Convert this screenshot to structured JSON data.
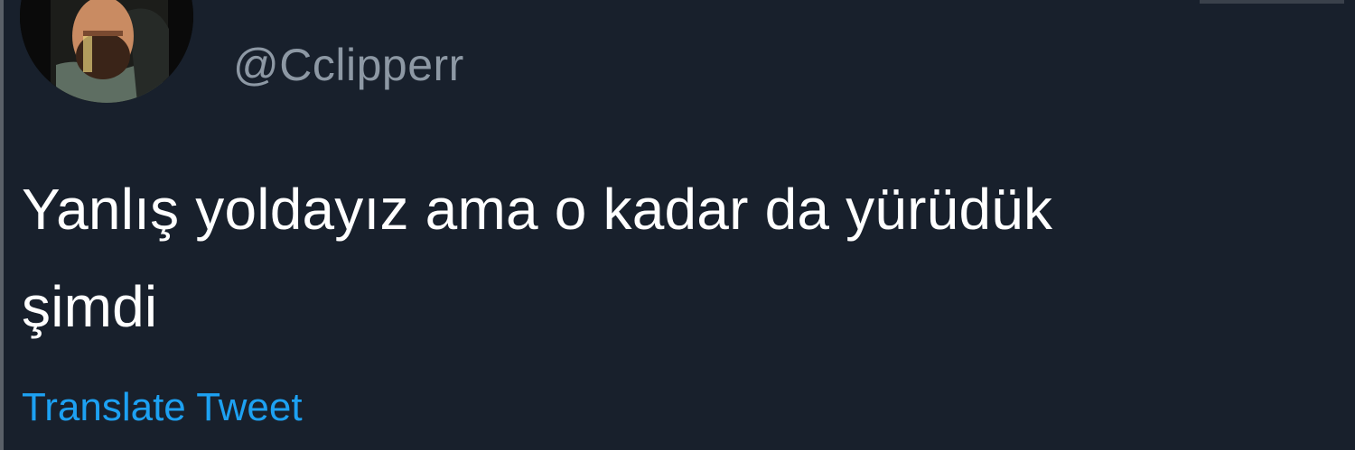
{
  "tweet": {
    "handle": "@Cclipperr",
    "text_line_1": "Yanlış yoldayız ama o kadar da yürüdük",
    "text_line_2": "şimdi",
    "translate_label": "Translate Tweet"
  },
  "colors": {
    "background": "#18202c",
    "text": "#ffffff",
    "handle": "#8d98a4",
    "link": "#1da1f2"
  },
  "icons": {
    "avatar": "profile-photo"
  }
}
